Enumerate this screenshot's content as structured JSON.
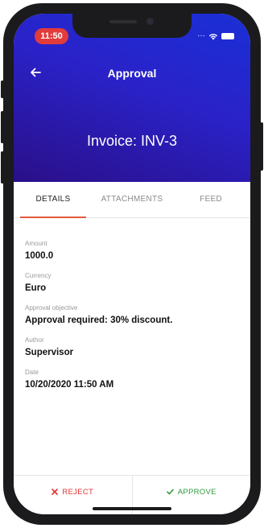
{
  "status_bar": {
    "time": "11:50"
  },
  "header": {
    "title": "Approval",
    "invoice_title": "Invoice: INV-3"
  },
  "tabs": [
    {
      "label": "DETAILS",
      "active": true
    },
    {
      "label": "ATTACHMENTS",
      "active": false
    },
    {
      "label": "FEED",
      "active": false
    }
  ],
  "fields": [
    {
      "label": "Amount",
      "value": "1000.0"
    },
    {
      "label": "Currency",
      "value": "Euro"
    },
    {
      "label": "Approval objective",
      "value": "Approval required: 30% discount."
    },
    {
      "label": "Author",
      "value": "Supervisor"
    },
    {
      "label": "Date",
      "value": "10/20/2020 11:50 AM"
    }
  ],
  "footer": {
    "reject_label": "REJECT",
    "approve_label": "APPROVE"
  },
  "colors": {
    "accent": "#e25a3a",
    "reject": "#e23232",
    "approve": "#2e9b3e",
    "header_start": "#1a2fd6",
    "header_end": "#2a0f88"
  },
  "icons": {
    "back": "arrow-left-icon",
    "reject": "x-icon",
    "approve": "checkmark-icon"
  }
}
